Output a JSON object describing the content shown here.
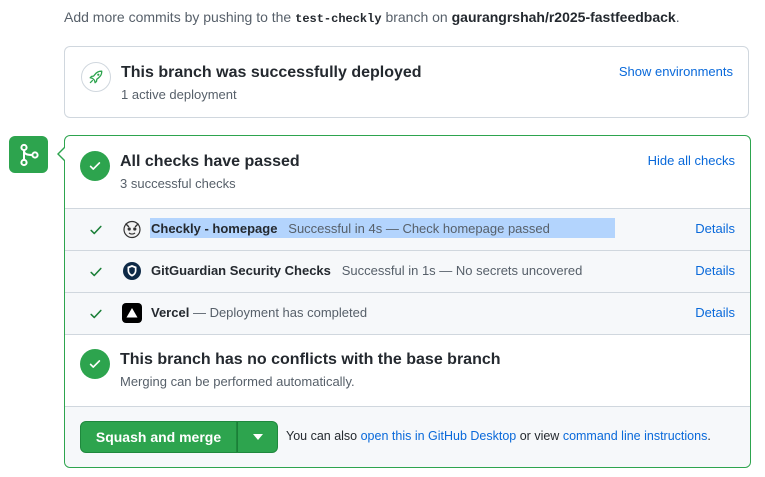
{
  "intro": {
    "prefix": "Add more commits by pushing to the",
    "branch": "test-checkly",
    "middle": "branch on",
    "repo": "gaurangrshah/r2025-fastfeedback",
    "suffix": "."
  },
  "deployment": {
    "title": "This branch was successfully deployed",
    "subtitle": "1 active deployment",
    "action": "Show environments"
  },
  "checks": {
    "title": "All checks have passed",
    "subtitle": "3 successful checks",
    "action": "Hide all checks",
    "items": [
      {
        "name": "Checkly - homepage",
        "separator": "",
        "description": "Successful in 4s — Check homepage passed",
        "details": "Details",
        "icon": "checkly-icon"
      },
      {
        "name": "GitGuardian Security Checks",
        "separator": "",
        "description": "Successful in 1s — No secrets uncovered",
        "details": "Details",
        "icon": "gitguardian-icon"
      },
      {
        "name": "Vercel",
        "separator": " — ",
        "description": "Deployment has completed",
        "details": "Details",
        "icon": "vercel-icon"
      }
    ]
  },
  "conflicts": {
    "title": "This branch has no conflicts with the base branch",
    "subtitle": "Merging can be performed automatically."
  },
  "merge": {
    "button_label": "Squash and merge",
    "hint_prefix": "You can also",
    "desktop_link": "open this in GitHub Desktop",
    "hint_middle": "or view",
    "cli_link": "command line instructions",
    "hint_suffix": "."
  },
  "colors": {
    "success": "#2da44e",
    "link": "#0969da",
    "highlight": "#b3d4fd"
  }
}
